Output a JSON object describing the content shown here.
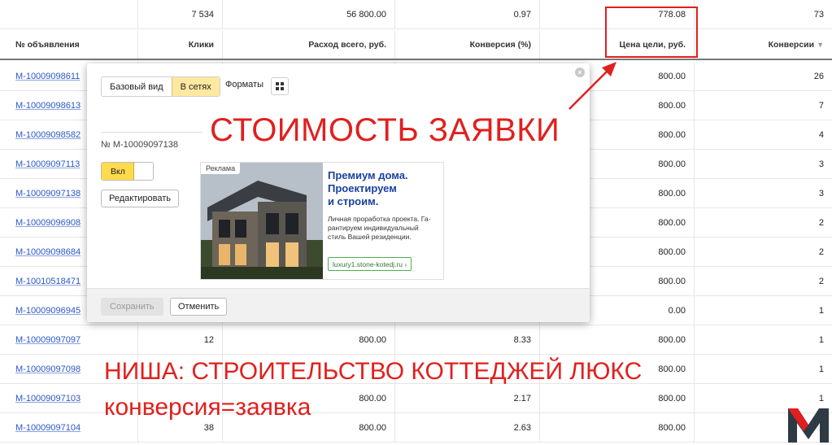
{
  "table": {
    "totals": [
      "",
      "7 534",
      "56 800.00",
      "0.97",
      "778.08",
      "73"
    ],
    "headers": [
      "№ объявления",
      "Клики",
      "Расход всего, руб.",
      "Конверсия (%)",
      "Цена цели, руб.",
      "Конверсии"
    ],
    "sort_icon": "triangle-down-icon",
    "rows": [
      {
        "id": "M-10009098611",
        "c1": "",
        "c2": "",
        "c3": "",
        "c4": "800.00",
        "c5": "26"
      },
      {
        "id": "M-10009098613",
        "c1": "",
        "c2": "",
        "c3": "",
        "c4": "800.00",
        "c5": "7"
      },
      {
        "id": "M-10009098582",
        "c1": "",
        "c2": "",
        "c3": "",
        "c4": "800.00",
        "c5": "4"
      },
      {
        "id": "M-10009097113",
        "c1": "",
        "c2": "",
        "c3": "",
        "c4": "800.00",
        "c5": "3"
      },
      {
        "id": "M-10009097138",
        "c1": "",
        "c2": "",
        "c3": "",
        "c4": "800.00",
        "c5": "3"
      },
      {
        "id": "M-10009096908",
        "c1": "",
        "c2": "",
        "c3": "",
        "c4": "800.00",
        "c5": "2"
      },
      {
        "id": "M-10009098684",
        "c1": "",
        "c2": "",
        "c3": "",
        "c4": "800.00",
        "c5": "2"
      },
      {
        "id": "M-10010518471",
        "c1": "",
        "c2": "",
        "c3": "",
        "c4": "800.00",
        "c5": "2"
      },
      {
        "id": "M-10009096945",
        "c1": "",
        "c2": "",
        "c3": "",
        "c4": "0.00",
        "c5": "1"
      },
      {
        "id": "M-10009097097",
        "c1": "12",
        "c2": "800.00",
        "c3": "8.33",
        "c4": "800.00",
        "c5": "1"
      },
      {
        "id": "M-10009097098",
        "c1": "",
        "c2": "",
        "c3": "",
        "c4": "800.00",
        "c5": "1"
      },
      {
        "id": "M-10009097103",
        "c1": "",
        "c2": "800.00",
        "c3": "2.17",
        "c4": "800.00",
        "c5": "1"
      },
      {
        "id": "M-10009097104",
        "c1": "38",
        "c2": "800.00",
        "c3": "2.63",
        "c4": "800.00",
        "c5": "1"
      }
    ]
  },
  "popup": {
    "tabs": [
      "Базовый вид",
      "В сетях"
    ],
    "active_tab": "В сетях",
    "formats_label": "Форматы",
    "ad_number": "№ M-10009097138",
    "toggle_label": "Вкл",
    "edit_label": "Редактировать",
    "save_label": "Сохранить",
    "cancel_label": "Отменить",
    "ad": {
      "badge": "Реклама",
      "title_lines": [
        "Премиум дома.",
        "Проектируем",
        "и строим."
      ],
      "body_lines": [
        "Личная проработка проекта. Га-",
        "рантируем индивидуальный",
        "стиль Вашей резиденции."
      ],
      "url": "luxury1.stone-kotedj.ru ›"
    }
  },
  "annotations": {
    "headline": "СТОИМОСТЬ ЗАЯВКИ",
    "niche": "НИША: СТРОИТЕЛЬСТВО КОТТЕДЖЕЙ ЛЮКС",
    "conversion": "конверсия=заявка",
    "accent_color": "#e0201e"
  },
  "logo": {
    "icon": "m-letter-logo-icon",
    "colors": [
      "#e0201e",
      "#2e3a44"
    ]
  }
}
